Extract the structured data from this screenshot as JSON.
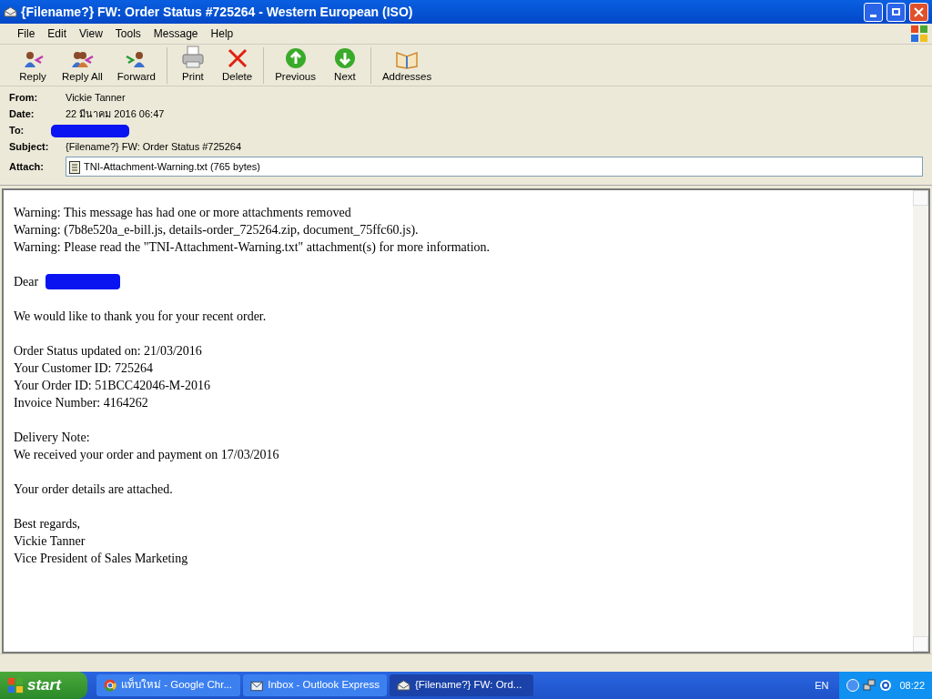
{
  "window": {
    "title": "{Filename?} FW: Order Status #725264 - Western European (ISO)"
  },
  "menu": [
    "File",
    "Edit",
    "View",
    "Tools",
    "Message",
    "Help"
  ],
  "toolbar": [
    {
      "kind": "reply",
      "label": "Reply"
    },
    {
      "kind": "replyall",
      "label": "Reply All"
    },
    {
      "kind": "forward",
      "label": "Forward"
    },
    {
      "kind": "sep"
    },
    {
      "kind": "print",
      "label": "Print"
    },
    {
      "kind": "delete",
      "label": "Delete"
    },
    {
      "kind": "sep"
    },
    {
      "kind": "up",
      "label": "Previous"
    },
    {
      "kind": "down",
      "label": "Next"
    },
    {
      "kind": "sep"
    },
    {
      "kind": "book",
      "label": "Addresses"
    }
  ],
  "header": [
    {
      "label": "From:",
      "value": "Vickie Tanner",
      "redacted": false
    },
    {
      "label": "Date:",
      "value": "22 มีนาคม 2016 06:47",
      "redacted": false
    },
    {
      "label": "To:",
      "redacted": true
    },
    {
      "label": "Subject:",
      "value": "{Filename?} FW: Order Status #725264",
      "redacted": false
    }
  ],
  "attach": {
    "label": "Attach:",
    "file": "TNI-Attachment-Warning.txt (765 bytes)"
  },
  "body": [
    {
      "lines": [
        {
          "text": "Warning: This message has had one or more attachments removed",
          "redacted": false
        },
        {
          "text": "Warning: (7b8e520a_e-bill.js, details-order_725264.zip, document_75ffc60.js).",
          "redacted": false
        },
        {
          "text": "Warning: Please read the \"TNI-Attachment-Warning.txt\" attachment(s) for more information.",
          "redacted": false
        }
      ]
    },
    {
      "lines": [
        {
          "text": "Dear",
          "redacted": true
        }
      ]
    },
    {
      "lines": [
        {
          "text": "We would like to thank you for your recent order.",
          "redacted": false
        }
      ]
    },
    {
      "lines": [
        {
          "text": "Order Status updated on: 21/03/2016",
          "redacted": false
        },
        {
          "text": "Your Customer ID: 725264",
          "redacted": false
        },
        {
          "text": "Your Order ID: 51BCC42046-M-2016",
          "redacted": false
        },
        {
          "text": "Invoice Number: 4164262",
          "redacted": false
        }
      ]
    },
    {
      "lines": [
        {
          "text": "Delivery Note:",
          "redacted": false
        },
        {
          "text": "We received your order and payment on 17/03/2016",
          "redacted": false
        }
      ]
    },
    {
      "lines": [
        {
          "text": "Your order details are attached.",
          "redacted": false
        }
      ]
    },
    {
      "lines": [
        {
          "text": "Best regards,",
          "redacted": false
        },
        {
          "text": "Vickie Tanner",
          "redacted": false
        },
        {
          "text": "Vice President of Sales Marketing",
          "redacted": false
        }
      ]
    }
  ],
  "taskbar": {
    "start": "start",
    "items": [
      {
        "kind": "chrome",
        "label": "แท็บใหม่ - Google Chr...",
        "selected": false
      },
      {
        "kind": "inbox",
        "label": "Inbox - Outlook Express",
        "selected": false
      },
      {
        "kind": "mail",
        "label": "{Filename?} FW: Ord...",
        "selected": true
      }
    ],
    "lang": "EN",
    "time": "08:22"
  }
}
